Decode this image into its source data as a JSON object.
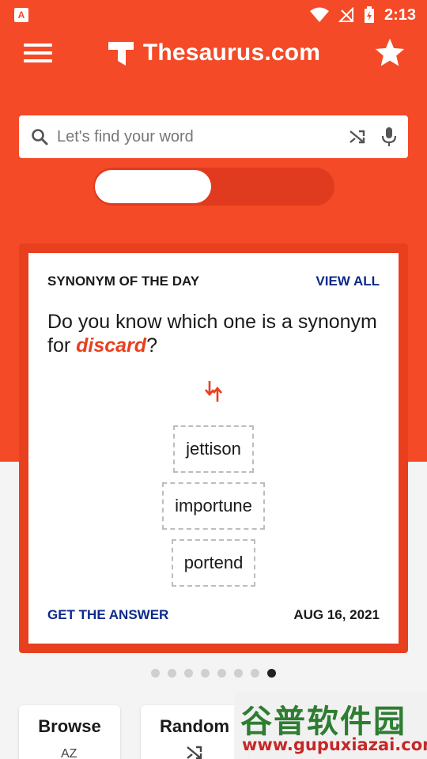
{
  "status_bar": {
    "app_badge": "A",
    "time": "2:13"
  },
  "app_bar": {
    "logo_text": "Thesaurus.com"
  },
  "search": {
    "placeholder": "Let's find your word"
  },
  "card": {
    "title": "SYNONYM OF THE DAY",
    "view_all": "VIEW ALL",
    "question_prefix": "Do you know which one is a synonym for ",
    "word": "discard",
    "question_suffix": "?",
    "options": [
      "jettison",
      "importune",
      "portend"
    ],
    "get_answer": "GET THE ANSWER",
    "date": "AUG 16, 2021"
  },
  "pager": {
    "count": 8,
    "active_index": 7
  },
  "tiles": [
    {
      "label": "Browse",
      "icon": "az-sort-icon"
    },
    {
      "label": "Random",
      "icon": "shuffle-icon"
    }
  ],
  "watermark": {
    "cn": "谷普软件园",
    "url": "www.gupuxiazai.com"
  },
  "colors": {
    "brand": "#f44a27",
    "link": "#0b2a8a"
  }
}
